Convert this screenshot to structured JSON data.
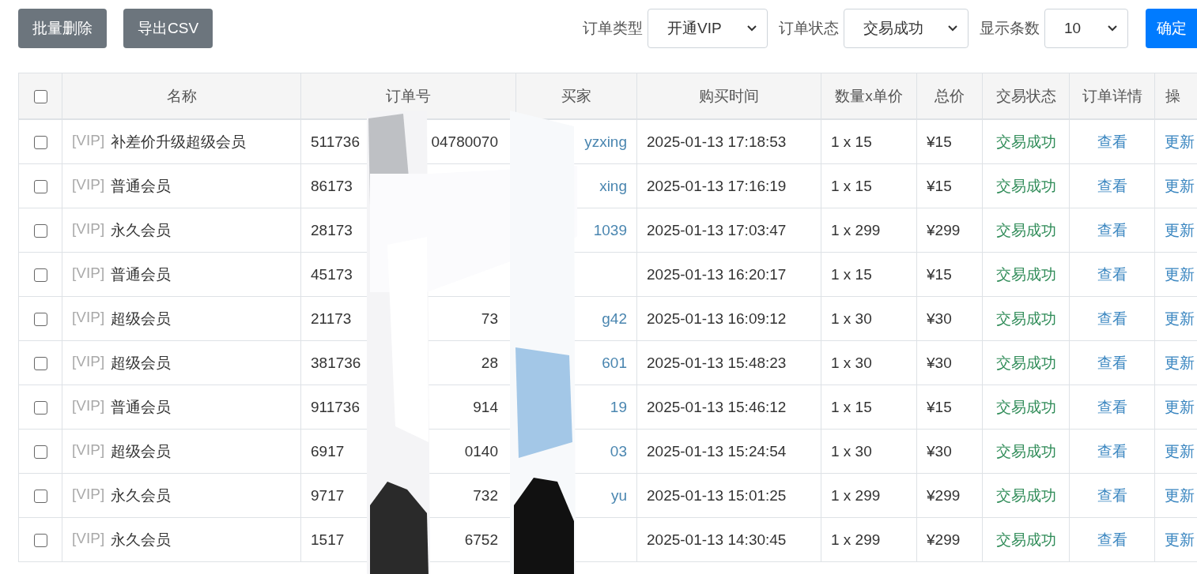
{
  "toolbar": {
    "buttons": [
      "批量删除",
      "导出CSV"
    ],
    "filters": [
      {
        "label": "订单类型",
        "value": "开通VIP"
      },
      {
        "label": "订单状态",
        "value": "交易成功"
      },
      {
        "label": "显示条数",
        "value": "10"
      }
    ],
    "confirm": "确定"
  },
  "table": {
    "select_all": {
      "checked": false
    },
    "columns": [
      "名称",
      "订单号",
      "买家",
      "购买时间",
      "数量x单价",
      "总价",
      "交易状态",
      "订单详情",
      "操"
    ],
    "rows": [
      {
        "checked": false,
        "tag": "[VIP]",
        "name": "补差价升级超级会员",
        "order_start": "511736",
        "order_end": "04780070",
        "buyer": "yzxing",
        "time": "2025-01-13 17:18:53",
        "qty": "1 x 15",
        "total": "¥15",
        "status": "交易成功",
        "detail": "查看",
        "action": "更新"
      },
      {
        "checked": false,
        "tag": "[VIP]",
        "name": "普通会员",
        "order_start": "86173",
        "order_end": "",
        "buyer": "xing",
        "time": "2025-01-13 17:16:19",
        "qty": "1 x 15",
        "total": "¥15",
        "status": "交易成功",
        "detail": "查看",
        "action": "更新"
      },
      {
        "checked": false,
        "tag": "[VIP]",
        "name": "永久会员",
        "order_start": "28173",
        "order_end": "",
        "buyer": "1039",
        "time": "2025-01-13 17:03:47",
        "qty": "1 x 299",
        "total": "¥299",
        "status": "交易成功",
        "detail": "查看",
        "action": "更新"
      },
      {
        "checked": false,
        "tag": "[VIP]",
        "name": "普通会员",
        "order_start": "45173",
        "order_end": "",
        "buyer": "",
        "time": "2025-01-13 16:20:17",
        "qty": "1 x 15",
        "total": "¥15",
        "status": "交易成功",
        "detail": "查看",
        "action": "更新"
      },
      {
        "checked": false,
        "tag": "[VIP]",
        "name": "超级会员",
        "order_start": "21173",
        "order_end": "73",
        "buyer": "g42",
        "time": "2025-01-13 16:09:12",
        "qty": "1 x 30",
        "total": "¥30",
        "status": "交易成功",
        "detail": "查看",
        "action": "更新"
      },
      {
        "checked": false,
        "tag": "[VIP]",
        "name": "超级会员",
        "order_start": "381736",
        "order_end": "28",
        "buyer": "601",
        "time": "2025-01-13 15:48:23",
        "qty": "1 x 30",
        "total": "¥30",
        "status": "交易成功",
        "detail": "查看",
        "action": "更新"
      },
      {
        "checked": false,
        "tag": "[VIP]",
        "name": "普通会员",
        "order_start": "911736",
        "order_end": "914",
        "buyer": "19",
        "time": "2025-01-13 15:46:12",
        "qty": "1 x 15",
        "total": "¥15",
        "status": "交易成功",
        "detail": "查看",
        "action": "更新"
      },
      {
        "checked": false,
        "tag": "[VIP]",
        "name": "超级会员",
        "order_start": "6917",
        "order_end": "0140",
        "buyer": "03",
        "time": "2025-01-13 15:24:54",
        "qty": "1 x 30",
        "total": "¥30",
        "status": "交易成功",
        "detail": "查看",
        "action": "更新"
      },
      {
        "checked": false,
        "tag": "[VIP]",
        "name": "永久会员",
        "order_start": "9717",
        "order_end": "732",
        "buyer": "yu",
        "time": "2025-01-13 15:01:25",
        "qty": "1 x 299",
        "total": "¥299",
        "status": "交易成功",
        "detail": "查看",
        "action": "更新"
      },
      {
        "checked": false,
        "tag": "[VIP]",
        "name": "永久会员",
        "order_start": "1517",
        "order_end": "6752",
        "buyer": "",
        "time": "2025-01-13 14:30:45",
        "qty": "1 x 299",
        "total": "¥299",
        "status": "交易成功",
        "detail": "查看",
        "action": "更新"
      }
    ]
  }
}
